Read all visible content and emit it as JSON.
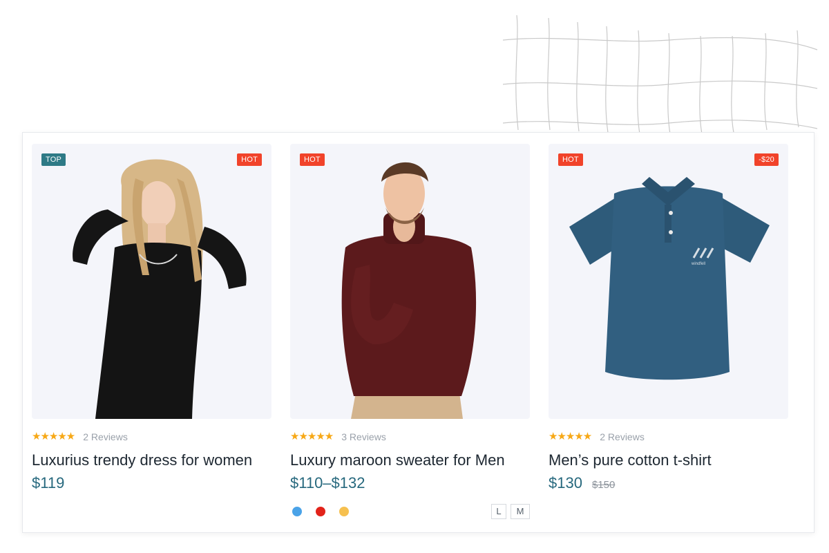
{
  "products": [
    {
      "badge_left": "TOP",
      "badge_left_color": "#2e7a86",
      "badge_right": "HOT",
      "badge_right_color": "#f1432a",
      "image": "woman-in-black-dress",
      "stars": "★★★★★",
      "reviews": "2 Reviews",
      "title": "Luxurius trendy dress for women",
      "price": "$119"
    },
    {
      "badge_left": "HOT",
      "badge_left_color": "#f1432a",
      "image": "man-in-maroon-sweater",
      "stars": "★★★★★",
      "reviews": "3 Reviews",
      "title": "Luxury maroon sweater for Men",
      "price": "$110–$132",
      "swatches": [
        "#4aa3e8",
        "#e2231a",
        "#f6c04f"
      ],
      "sizes": [
        "L",
        "M"
      ]
    },
    {
      "badge_left": "HOT",
      "badge_left_color": "#f1432a",
      "badge_right": "-$20",
      "badge_right_color": "#f1432a",
      "image": "blue-polo-shirt",
      "logo_text": "windfell",
      "stars": "★★★★★",
      "reviews": "2 Reviews",
      "title": "Men’s pure cotton t-shirt",
      "price": "$130",
      "old_price": "$150"
    }
  ],
  "colors": {
    "accent_price": "#26687d",
    "star": "#f7a816",
    "image_bg": "#f4f5fa"
  }
}
